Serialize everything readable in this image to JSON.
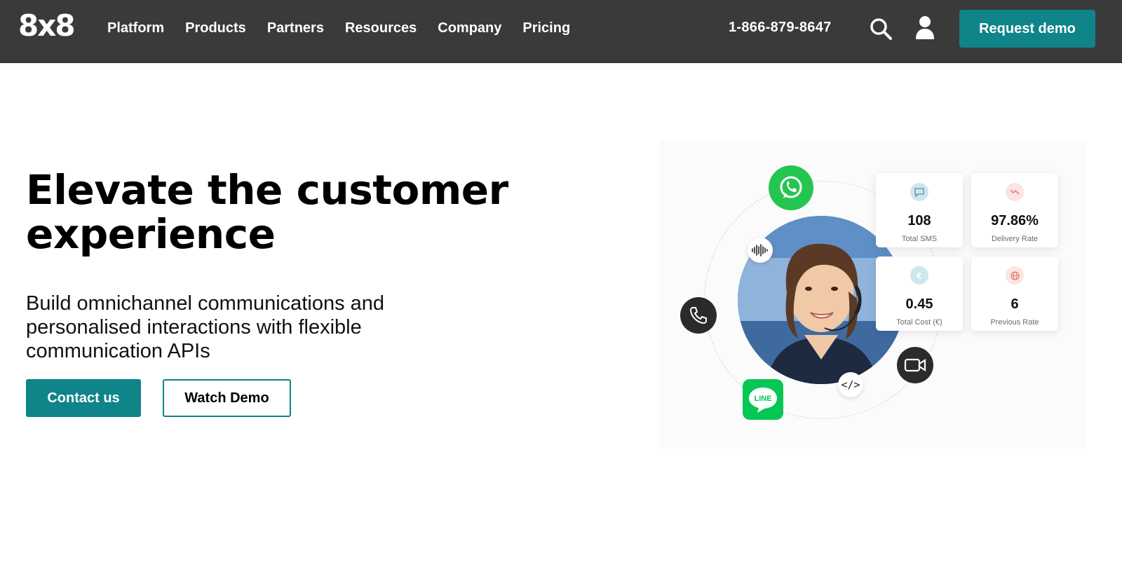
{
  "nav": {
    "logo": "8x8",
    "links": [
      "Platform",
      "Products",
      "Partners",
      "Resources",
      "Company",
      "Pricing"
    ],
    "phone": "1-866-879-8647",
    "request_demo": "Request demo",
    "icons": [
      "search-icon",
      "user-icon"
    ]
  },
  "hero": {
    "title_line1": "Elevate the customer",
    "title_line2": "experience",
    "subtitle": "Build omnichannel communications and personalised interactions with flexible communication APIs",
    "contact_button": "Contact us",
    "watch_button": "Watch Demo"
  },
  "illustration": {
    "code_icon": "</>",
    "line_label": "LINE",
    "stats": [
      {
        "value": "108",
        "label": "Total SMS",
        "icon": "message-icon",
        "color": "#cfe6ee"
      },
      {
        "value": "97.86%",
        "label": "Delivery Rate",
        "icon": "trend-down-icon",
        "color": "#fbe4e2"
      },
      {
        "value": "0.45",
        "label": "Total Cost (€)",
        "icon": "euro-icon",
        "color": "#cfe6ee"
      },
      {
        "value": "6",
        "label": "Previous Rate",
        "icon": "globe-icon",
        "color": "#fbe4e2"
      }
    ]
  },
  "colors": {
    "nav_bg": "#3a3a3a",
    "accent": "#0f8489",
    "whatsapp": "#25c552",
    "line": "#06c755"
  }
}
